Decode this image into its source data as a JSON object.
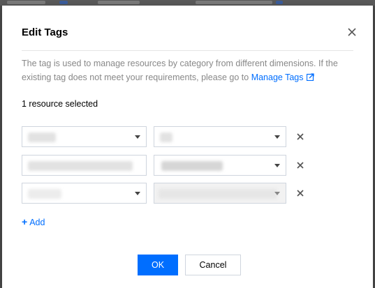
{
  "dialog": {
    "title": "Edit Tags",
    "description": "The tag is used to manage resources by category from different dimensions. If the existing tag does not meet your requirements, please go to",
    "manage_link": "Manage Tags",
    "selected_count": "1 resource selected"
  },
  "tag_rows": [
    {
      "key": "",
      "value": ""
    },
    {
      "key": "",
      "value": ""
    },
    {
      "key": "",
      "value": ""
    }
  ],
  "add_label": "Add",
  "buttons": {
    "ok": "OK",
    "cancel": "Cancel"
  },
  "colors": {
    "accent": "#006eff",
    "muted_text": "#888888",
    "border": "#cfd5de"
  },
  "icons": {
    "close": "close-icon",
    "external": "external-link-icon",
    "remove": "remove-icon",
    "add": "plus-icon"
  }
}
